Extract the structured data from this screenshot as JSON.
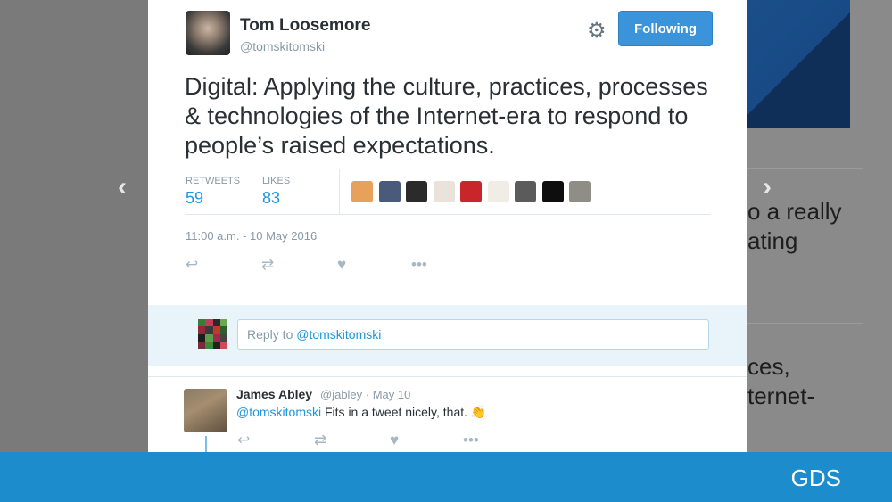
{
  "background": {
    "right_text_1": "o a really\nating",
    "right_text_2": "ces,\nternet-"
  },
  "nav": {
    "prev_label": "‹",
    "next_label": "›"
  },
  "tweet": {
    "author_name": "Tom Loosemore",
    "author_handle": "@tomskitomski",
    "follow_label": "Following",
    "text": "Digital: Applying the culture, practices, processes & technologies of the Internet-era to respond to people’s raised expectations.",
    "retweets_label": "RETWEETS",
    "retweets_count": "59",
    "likes_label": "LIKES",
    "likes_count": "83",
    "timestamp": "11:00 a.m. - 10 May 2016",
    "likers": [
      {
        "color": "#e8a15a"
      },
      {
        "color": "#4a5a7a"
      },
      {
        "color": "#2b2b2b"
      },
      {
        "color": "#e9e3dc"
      },
      {
        "color": "#c8262b"
      },
      {
        "color": "#f0ece6"
      },
      {
        "color": "#5b5b5b"
      },
      {
        "color": "#0e0e0e"
      },
      {
        "color": "#8e8e86"
      }
    ]
  },
  "reply_box": {
    "prefix": "Reply to ",
    "mention": "@tomskitomski"
  },
  "reply": {
    "author_name": "James Abley",
    "meta": "@jabley · May 10",
    "mention": "@tomskitomski",
    "text": " Fits in a tweet nicely, that. 👏"
  },
  "footer": {
    "logo": "GDS"
  },
  "colors": {
    "accent": "#1b95e0",
    "follow_button": "#3b94d9",
    "footer": "#1d8ccc"
  }
}
